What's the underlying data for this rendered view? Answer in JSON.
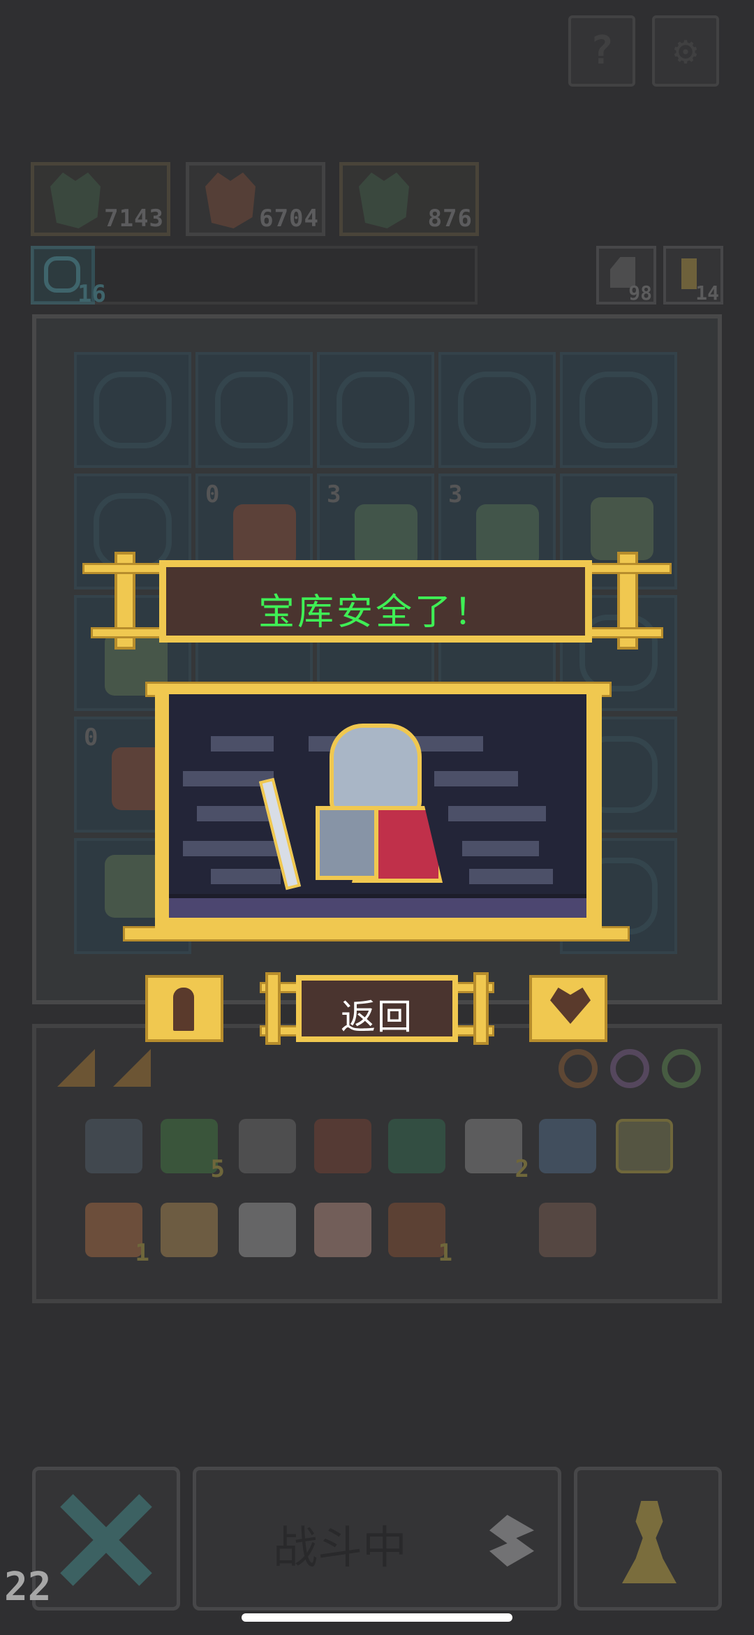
{
  "header": {
    "help_icon_label": "?",
    "settings_icon_label": "⚙"
  },
  "heroes": [
    {
      "name": "goblin-king",
      "value": "7143"
    },
    {
      "name": "fox-warrior",
      "value": "6704"
    },
    {
      "name": "goblin-king",
      "value": "876"
    }
  ],
  "status": {
    "gems": "16",
    "tomb_count": "98",
    "key_count": "14"
  },
  "board": {
    "levels": [
      "0",
      "3",
      "3",
      "0"
    ]
  },
  "modal": {
    "title": "宝库安全了！",
    "return_label": "返回"
  },
  "inventory": {
    "counts": [
      "5",
      "2",
      "1",
      "1"
    ]
  },
  "footer": {
    "battle_label": "战斗中",
    "counter": "22"
  },
  "colors": {
    "gold": "#f0c850",
    "banner_bg": "#4a342f",
    "title_text": "#3fef55",
    "board_cell": "#2e4a5a"
  }
}
